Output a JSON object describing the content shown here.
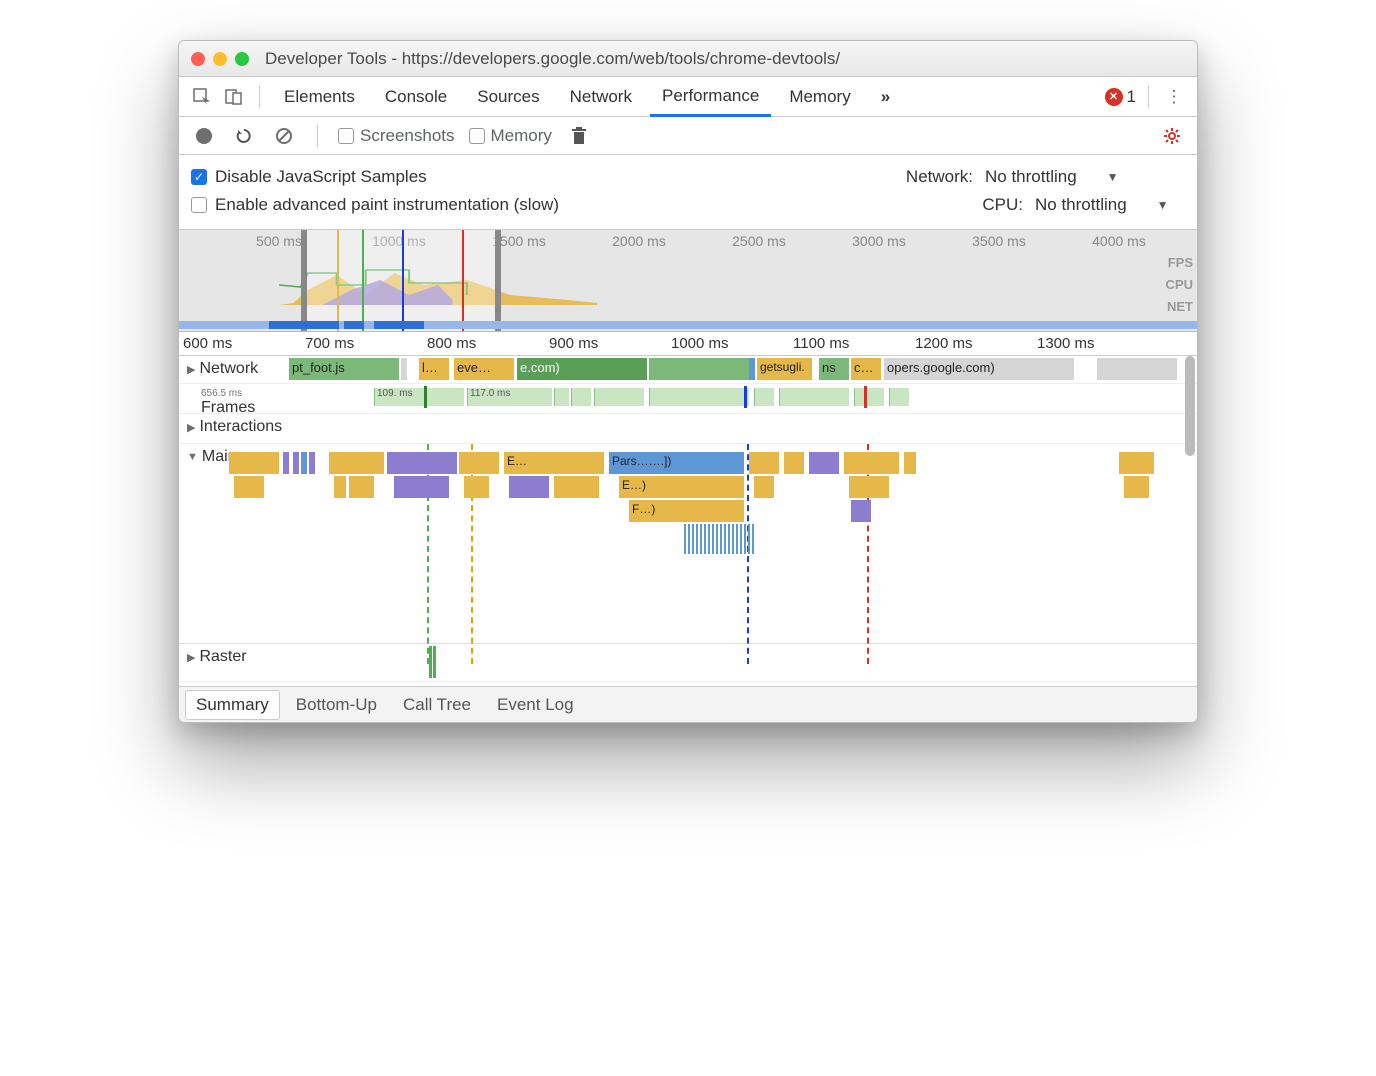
{
  "window": {
    "title": "Developer Tools - https://developers.google.com/web/tools/chrome-devtools/"
  },
  "panels": {
    "items": [
      "Elements",
      "Console",
      "Sources",
      "Network",
      "Performance",
      "Memory"
    ],
    "active": "Performance",
    "more_icon": "»",
    "errors": "1"
  },
  "toolbar2": {
    "screenshots_label": "Screenshots",
    "memory_label": "Memory"
  },
  "settings": {
    "disable_js": "Disable JavaScript Samples",
    "advanced_paint": "Enable advanced paint instrumentation (slow)",
    "network_label": "Network:",
    "network_value": "No throttling",
    "cpu_label": "CPU:",
    "cpu_value": "No throttling"
  },
  "overview": {
    "ticks": [
      "500 ms",
      "1000 ms",
      "1500 ms",
      "2000 ms",
      "2500 ms",
      "3000 ms",
      "3500 ms",
      "4000 ms"
    ],
    "labels": [
      "FPS",
      "CPU",
      "NET"
    ]
  },
  "ruler": {
    "ticks": [
      "600 ms",
      "700 ms",
      "800 ms",
      "900 ms",
      "1000 ms",
      "1100 ms",
      "1200 ms",
      "1300 ms"
    ]
  },
  "tracks": {
    "network": "Network",
    "frames": "Frames",
    "interactions": "Interactions",
    "main": "Main",
    "raster": "Raster",
    "frame_times": {
      "a": "656.5 ms",
      "b": "109. ms",
      "c": "117.0 ms"
    },
    "net_items": {
      "a": "pt_foot.js",
      "b": "l…",
      "c": "eve…",
      "d": "e.com)",
      "e": "getsugli.",
      "f": "ns",
      "g": "c…",
      "h": "opers.google.com)"
    },
    "flame": {
      "e": "E…",
      "pars": "Pars…….])",
      "e2": "E…)",
      "f": "F…)"
    }
  },
  "bottom_tabs": {
    "items": [
      "Summary",
      "Bottom-Up",
      "Call Tree",
      "Event Log"
    ],
    "active": "Summary"
  }
}
